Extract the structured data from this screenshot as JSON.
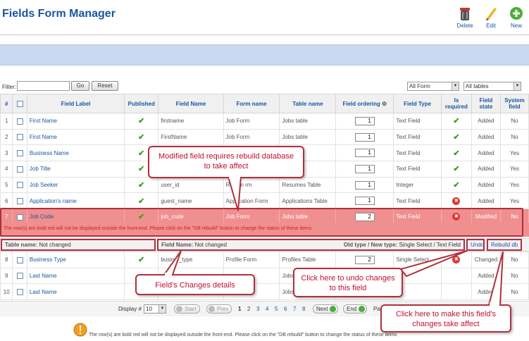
{
  "header": {
    "title": "Fields Form Manager",
    "toolbar": [
      {
        "label": "Delete",
        "icon": "trash-icon"
      },
      {
        "label": "Edit",
        "icon": "pencil-icon"
      },
      {
        "label": "New",
        "icon": "plus-icon"
      }
    ]
  },
  "filter": {
    "label": "Filter:",
    "value": "",
    "go_label": "Go",
    "reset_label": "Reset",
    "form_select": "All Form",
    "table_select": "All tables"
  },
  "columns": [
    "#",
    "",
    "Field Label",
    "Published",
    "Field Name",
    "Form name",
    "Table name",
    "Field ordering",
    "Field Type",
    "Is required",
    "Field state",
    "System field"
  ],
  "rows": [
    {
      "num": "1",
      "label": "First Name",
      "published": "✔",
      "name": "firstname",
      "form": "Job Form",
      "table": "Jobs table",
      "ordering": "1",
      "type": "Text Field",
      "required": "✔",
      "state": "Added",
      "system": "No"
    },
    {
      "num": "2",
      "label": "First Name",
      "published": "✔",
      "name": "FirstName",
      "form": "Job Form",
      "table": "Jobs table",
      "ordering": "1",
      "type": "Text Field",
      "required": "✔",
      "state": "Added",
      "system": "No"
    },
    {
      "num": "3",
      "label": "Business Name",
      "published": "✔",
      "name": "",
      "form": "",
      "table": "s Table",
      "ordering": "1",
      "type": "Text Field",
      "required": "✔",
      "state": "Added",
      "system": "Yes"
    },
    {
      "num": "4",
      "label": "Job Title",
      "published": "✔",
      "name": "",
      "form": "",
      "table": "able",
      "ordering": "1",
      "type": "Text Field",
      "required": "✔",
      "state": "Added",
      "system": "Yes"
    },
    {
      "num": "5",
      "label": "Job Seeker",
      "published": "✔",
      "name": "user_id",
      "form": "Resum     rm",
      "table": "Resumes Table",
      "ordering": "1",
      "type": "Integer",
      "required": "✔",
      "state": "Added",
      "system": "Yes"
    },
    {
      "num": "6",
      "label": "Application's name",
      "published": "✔",
      "name": "guest_name",
      "form": "Application Form",
      "table": "Applications Table",
      "ordering": "1",
      "type": "Text Field",
      "required": "✖",
      "state": "Added",
      "system": "Yes"
    }
  ],
  "red_row": {
    "num": "7",
    "label": "Job Code",
    "published": "✔",
    "name": "job_code",
    "form": "Job Form",
    "table": "Jobs table",
    "ordering": "2",
    "type": "Text Field",
    "required": "✖",
    "state": "Modified",
    "system": "No"
  },
  "red_message": "The row(s) are bold red will not be displayed outside the front-end. Please click on the \"DB rebuild\" button to change the status of these items",
  "details": {
    "table_name_label": "Table name:",
    "table_name_value": "Not changed",
    "field_name_label": "Field Name:",
    "field_name_value": "Not changed",
    "type_label": "Old type / New type:",
    "type_value": "Single Select / Text Field",
    "undo_label": "Undo",
    "rebuild_label": "Rebuild db"
  },
  "rows_after": [
    {
      "num": "8",
      "label": "Business Type",
      "published": "✔",
      "name": "busin     s_type",
      "form": "Profile Form",
      "table": "Profiles Table",
      "ordering": "2",
      "type": "Single Select",
      "required": "✖",
      "state": "Changed",
      "system": "No"
    },
    {
      "num": "9",
      "label": "Last Name",
      "published": "",
      "name": "",
      "form": "",
      "table": "Jobs",
      "ordering": "",
      "type": "",
      "required": "",
      "state": "Added",
      "system": "No"
    },
    {
      "num": "10",
      "label": "Last Name",
      "published": "",
      "name": "",
      "form": "",
      "table": "Jobs",
      "ordering": "",
      "type": "",
      "required": "",
      "state": "Added",
      "system": "No"
    }
  ],
  "pager": {
    "display_label": "Display #",
    "display_value": "10",
    "start": "Start",
    "prev": "Prev",
    "pages": [
      "1",
      "2",
      "3",
      "4",
      "5",
      "6",
      "7",
      "8"
    ],
    "next": "Next",
    "end": "End",
    "page_label": "Pa"
  },
  "callouts": {
    "modified": "Modified field requires rebuild database to take affect",
    "details": "Field's Changes details",
    "undo": "Click here to undo changes to this field",
    "rebuild": "Click here to make this field's changes take affect"
  },
  "bottom_note": "The row(s) are bold red will not be displayed outside the front-end. Please click on the \"DB rebuild\" button to change the status of these items",
  "colors": {
    "accent": "#1b55a3",
    "highlight_red": "#f08f8f",
    "callout_border": "#b0303c",
    "check_green": "#3f9b1d"
  }
}
